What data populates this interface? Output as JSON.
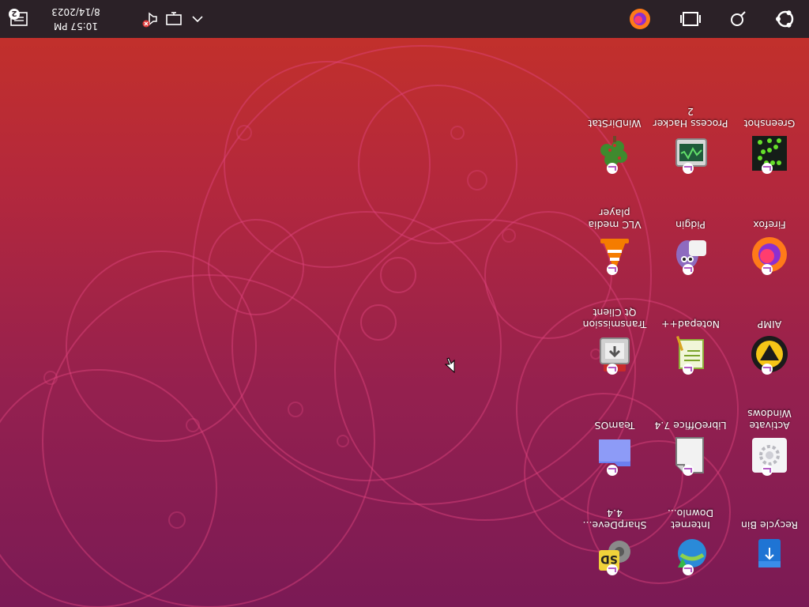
{
  "desktop": {
    "icons": [
      {
        "label": "Recycle Bin",
        "icon": "recycle-bin-icon"
      },
      {
        "label": "Activate Windows",
        "icon": "settings-gear-icon"
      },
      {
        "label": "AIMP",
        "icon": "aimp-icon"
      },
      {
        "label": "Firefox",
        "icon": "firefox-icon"
      },
      {
        "label": "Greenshot",
        "icon": "greenshot-icon"
      },
      {
        "label": "Internet Downlo...",
        "icon": "internet-download-manager-icon"
      },
      {
        "label": "LibreOffice 7.4",
        "icon": "libreoffice-icon"
      },
      {
        "label": "Notepad++",
        "icon": "notepad-plus-plus-icon"
      },
      {
        "label": "Pidgin",
        "icon": "pidgin-icon"
      },
      {
        "label": "Process Hacker 2",
        "icon": "process-hacker-icon"
      },
      {
        "label": "SharpDeve... 4.4",
        "icon": "sharpdevelop-icon"
      },
      {
        "label": "TeamOS",
        "icon": "folder-icon"
      },
      {
        "label": "Transmission Qt Client",
        "icon": "transmission-icon"
      },
      {
        "label": "VLC media player",
        "icon": "vlc-icon"
      },
      {
        "label": "WinDirStat",
        "icon": "windirstat-icon"
      }
    ]
  },
  "taskbar": {
    "start_icon": "ubuntu-logo-icon",
    "search_icon": "search-icon",
    "task_view_icon": "task-view-icon",
    "pinned_app_icon": "firefox-icon",
    "tray": {
      "chevron_icon": "chevron-up-icon",
      "network_icon": "network-disconnected-icon",
      "volume_icon": "volume-icon"
    },
    "clock": {
      "time": "10:57 PM",
      "date": "8/14/2023"
    },
    "notification_icon": "notification-icon",
    "notification_count": "2"
  },
  "colors": {
    "taskbar_bg": "#2b2127",
    "wallpaper_top": "#7a1a55",
    "wallpaper_bottom": "#c53227",
    "badge": "#b45cc6"
  }
}
